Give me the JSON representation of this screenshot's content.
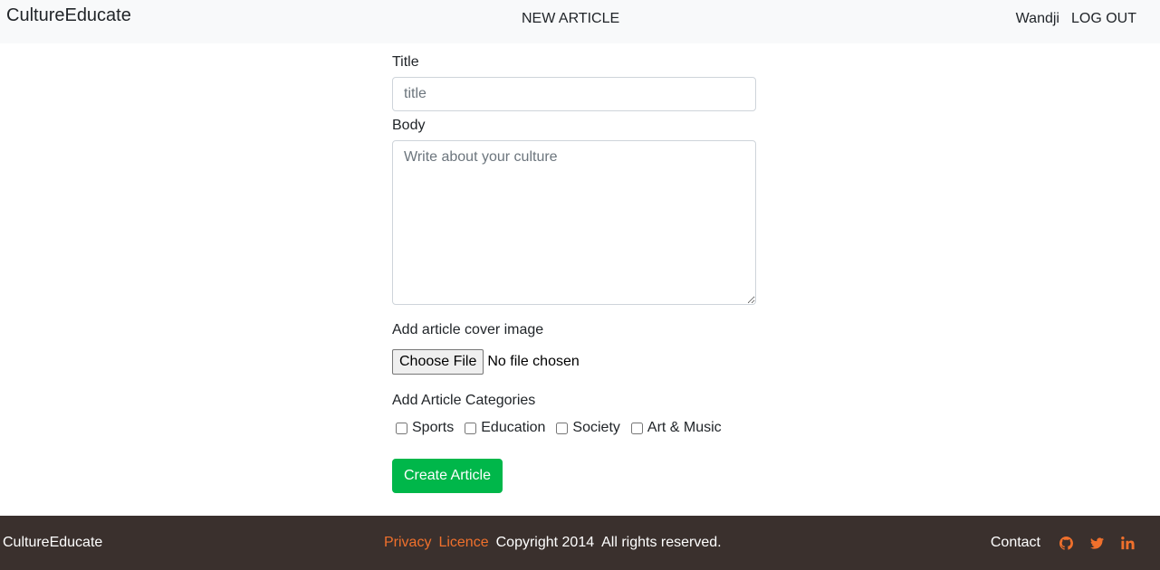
{
  "navbar": {
    "brand": "CultureEducate",
    "center_link": "NEW ARTICLE",
    "user": "Wandji",
    "logout": "LOG OUT"
  },
  "form": {
    "title_label": "Title",
    "title_placeholder": "title",
    "title_value": "",
    "body_label": "Body",
    "body_placeholder": "Write about your culture",
    "body_value": "",
    "cover_label": "Add article cover image",
    "file_button": "Choose File",
    "file_status": "No file chosen",
    "categories_label": "Add Article Categories",
    "categories": [
      {
        "label": "Sports",
        "checked": false
      },
      {
        "label": "Education",
        "checked": false
      },
      {
        "label": "Society",
        "checked": false
      },
      {
        "label": "Art & Music",
        "checked": false
      }
    ],
    "submit": "Create Article"
  },
  "footer": {
    "brand": "CultureEducate",
    "privacy": "Privacy",
    "licence": "Licence",
    "copyright": "Copyright 2014",
    "rights": "All rights reserved.",
    "contact": "Contact",
    "social_icons": [
      "github-icon",
      "twitter-icon",
      "linkedin-icon"
    ]
  },
  "colors": {
    "navbar_bg": "#f8f9fa",
    "footer_bg": "#3a302d",
    "accent_orange": "#f0702c",
    "button_green": "#00b74a"
  }
}
